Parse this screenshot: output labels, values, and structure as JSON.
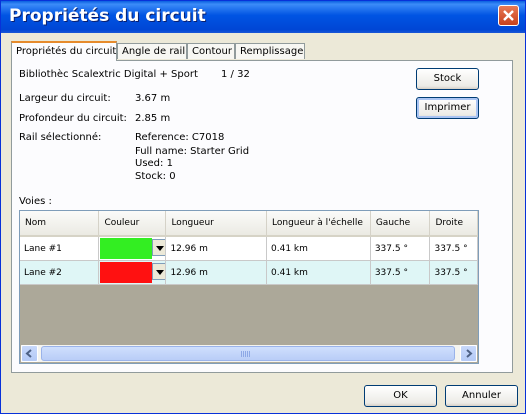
{
  "window": {
    "title": "Propriétés du circuit"
  },
  "tabs": [
    {
      "label": "Propriétés du circuit"
    },
    {
      "label": "Angle de rail"
    },
    {
      "label": "Contour"
    },
    {
      "label": "Remplissage"
    }
  ],
  "props": {
    "library": "Bibliothèc Scalextric Digital + Sport",
    "page": "1 / 32",
    "width_label": "Largeur du circuit:",
    "width_value": "3.67 m",
    "depth_label": "Profondeur du circuit:",
    "depth_value": "2.85 m",
    "rail_label": "Rail sélectionné:",
    "rail_reference": "Reference: C7018",
    "rail_fullname": "Full name: Starter Grid",
    "rail_used": "Used: 1",
    "rail_stock": "Stock: 0"
  },
  "buttons": {
    "stock": "Stock",
    "print": "Imprimer",
    "ok": "OK",
    "cancel": "Annuler"
  },
  "lanes": {
    "label": "Voies :",
    "columns": [
      "Nom",
      "Couleur",
      "Longueur",
      "Longueur à l'échelle",
      "Gauche",
      "Droite"
    ],
    "rows": [
      {
        "name": "Lane #1",
        "color": "#33ee22",
        "length": "12.96 m",
        "scaled": "0.41 km",
        "left": "337.5 °",
        "right": "337.5 °"
      },
      {
        "name": "Lane #2",
        "color": "#ff1111",
        "length": "12.96 m",
        "scaled": "0.41 km",
        "left": "337.5 °",
        "right": "337.5 °"
      }
    ]
  },
  "icons": {
    "close": "close-icon",
    "dropdown": "chevron-down-icon",
    "scroll_left": "arrow-left-icon",
    "scroll_right": "arrow-right-icon"
  }
}
